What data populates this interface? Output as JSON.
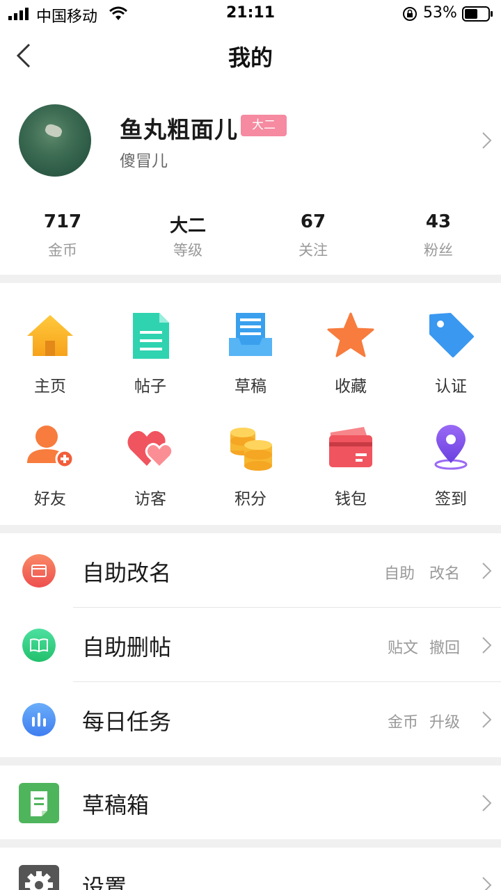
{
  "status_bar": {
    "carrier": "中国移动",
    "time": "21:11",
    "battery": "53%"
  },
  "nav": {
    "title": "我的"
  },
  "profile": {
    "name": "鱼丸粗面儿",
    "level_badge": "大二",
    "subtitle": "傻冒儿"
  },
  "stats": [
    {
      "value": "717",
      "label": "金币"
    },
    {
      "value": "大二",
      "label": "等级"
    },
    {
      "value": "67",
      "label": "关注"
    },
    {
      "value": "43",
      "label": "粉丝"
    }
  ],
  "grid": [
    {
      "label": "主页",
      "icon": "home-icon"
    },
    {
      "label": "帖子",
      "icon": "post-icon"
    },
    {
      "label": "草稿",
      "icon": "draft-icon"
    },
    {
      "label": "收藏",
      "icon": "star-icon"
    },
    {
      "label": "认证",
      "icon": "tag-icon"
    },
    {
      "label": "好友",
      "icon": "add-friend-icon"
    },
    {
      "label": "访客",
      "icon": "hearts-icon"
    },
    {
      "label": "积分",
      "icon": "coins-icon"
    },
    {
      "label": "钱包",
      "icon": "wallet-icon"
    },
    {
      "label": "签到",
      "icon": "location-pin-icon"
    }
  ],
  "list": [
    {
      "title": "自助改名",
      "extra1": "自助",
      "extra2": "改名",
      "icon": "rename-icon",
      "color": "#f0645a"
    },
    {
      "title": "自助删帖",
      "extra1": "贴文",
      "extra2": "撤回",
      "icon": "book-icon",
      "color": "#36cc7f"
    },
    {
      "title": "每日任务",
      "extra1": "金币",
      "extra2": "升级",
      "icon": "bar-chart-icon",
      "color": "#4d8cf5"
    }
  ],
  "list2": [
    {
      "title": "草稿箱",
      "icon": "draft-box-icon",
      "color": "#4fb55c"
    },
    {
      "title": "设置",
      "icon": "gear-icon",
      "color": "#555555"
    }
  ]
}
